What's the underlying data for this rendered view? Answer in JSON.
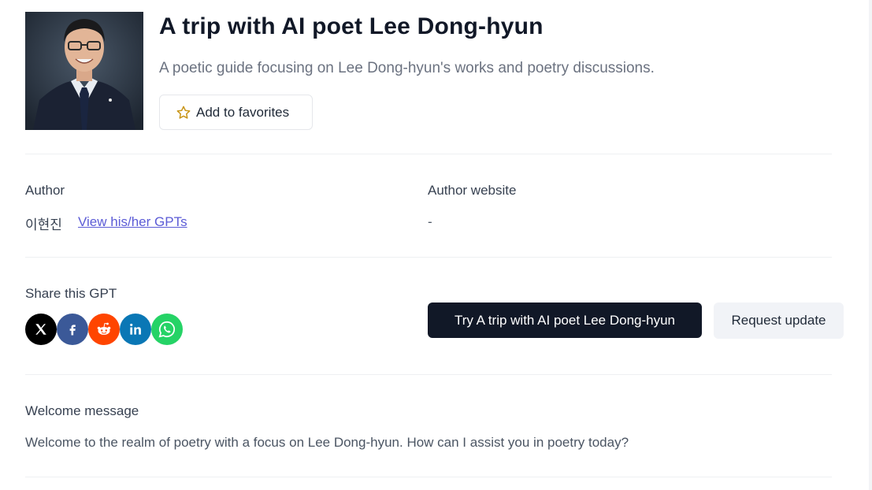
{
  "gpt": {
    "title": "A trip with AI poet Lee Dong-hyun",
    "description": "A poetic guide focusing on Lee Dong-hyun's works and poetry discussions.",
    "favorite_label": "Add to favorites",
    "avatar_icon": "author-portrait"
  },
  "author": {
    "label": "Author",
    "name": "이현진",
    "gpts_link": "View his/her GPTs",
    "website_label": "Author website",
    "website_value": "-"
  },
  "share": {
    "label": "Share this GPT",
    "icons": [
      "x-icon",
      "facebook-icon",
      "reddit-icon",
      "linkedin-icon",
      "whatsapp-icon"
    ],
    "colors": {
      "x": "#000000",
      "facebook": "#3b5998",
      "reddit": "#ff4500",
      "linkedin": "#0a77b5",
      "whatsapp": "#25d366"
    }
  },
  "actions": {
    "try_label": "Try A trip with AI poet Lee Dong-hyun",
    "request_label": "Request update"
  },
  "welcome": {
    "label": "Welcome message",
    "text": "Welcome to the realm of poetry with a focus on Lee Dong-hyun. How can I assist you in poetry today?"
  },
  "theme": {
    "primary": "#111827",
    "link": "#5b5bd6",
    "star": "#d4a017"
  }
}
